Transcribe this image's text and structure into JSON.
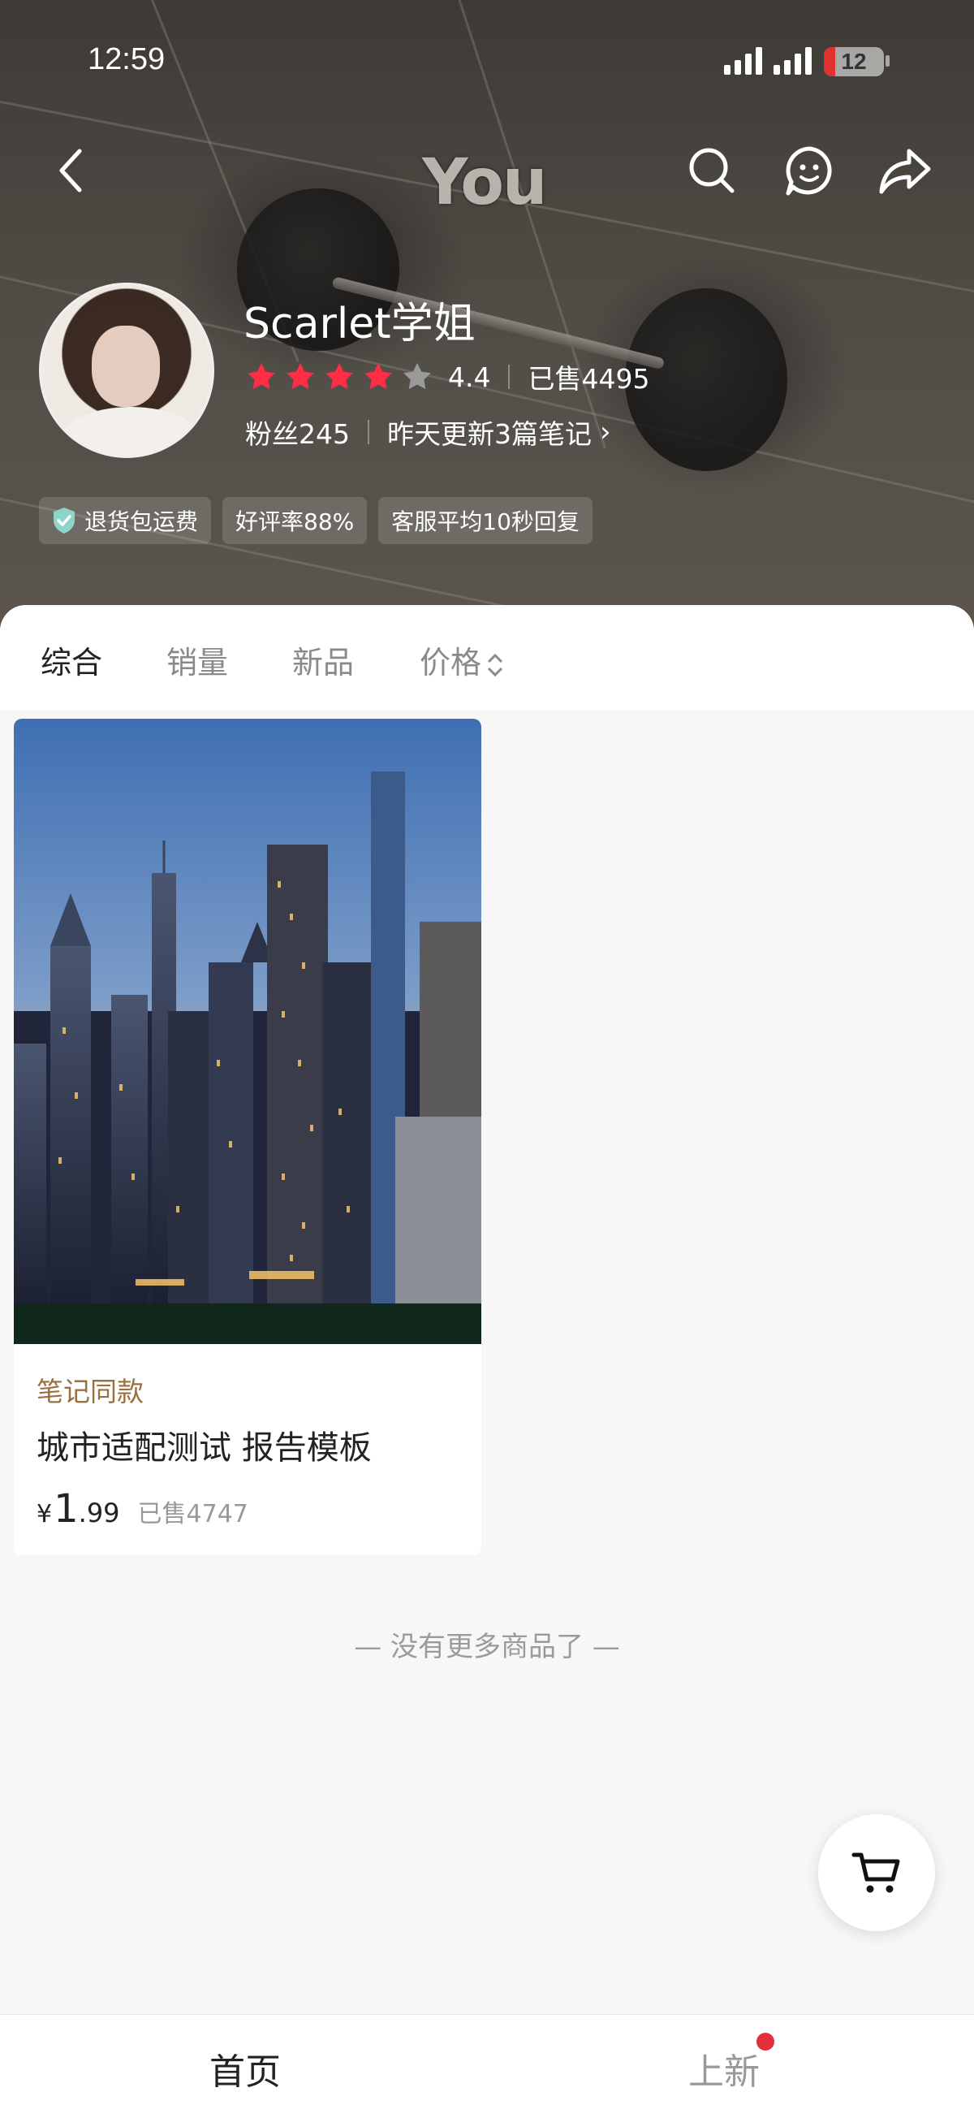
{
  "status_bar": {
    "time": "12:59",
    "battery": "12"
  },
  "hero": {
    "watermark": "You"
  },
  "shop": {
    "name": "Scarlet学姐",
    "rating": "4.4",
    "rating_stars": 4,
    "sold": "已售4495",
    "fans": "粉丝245",
    "update": "昨天更新3篇笔记",
    "badges": [
      "退货包运费",
      "好评率88%",
      "客服平均10秒回复"
    ]
  },
  "tabs": [
    "综合",
    "销量",
    "新品",
    "价格"
  ],
  "product": {
    "tag": "笔记同款",
    "title": "城市适配测试 报告模板",
    "price_symbol": "¥",
    "price_int": "1",
    "price_dec": ".99",
    "sold": "已售4747"
  },
  "no_more": "—  没有更多商品了  —",
  "bottom_nav": {
    "home": "首页",
    "new": "上新"
  },
  "colors": {
    "star_active": "#ff2d46",
    "star_inactive": "#9a9a9a",
    "accent_red": "#e2303a",
    "tag_brown": "#9a7040"
  }
}
